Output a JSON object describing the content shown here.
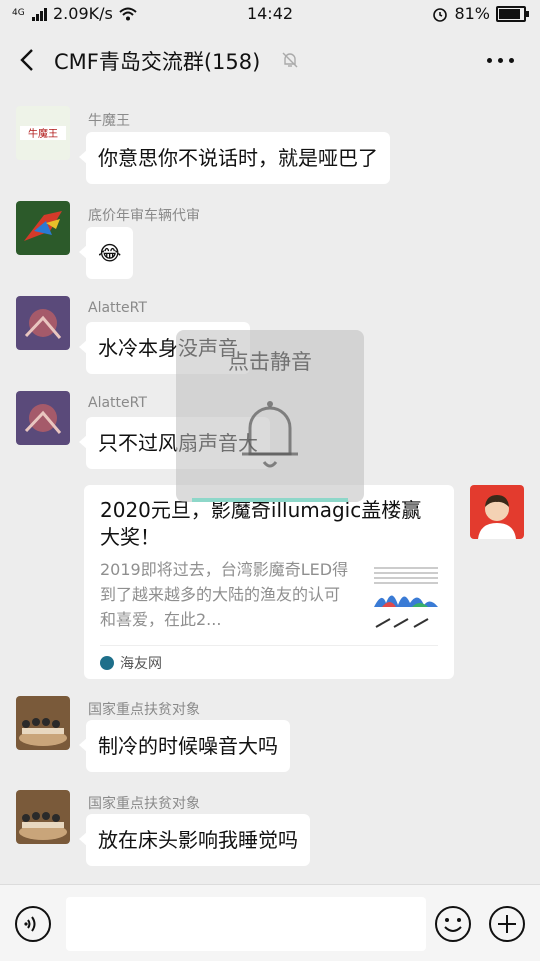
{
  "status_bar": {
    "network": "4G",
    "speed": "2.09K/s",
    "time": "14:42",
    "battery": "81%",
    "battery_level": 0.81
  },
  "header": {
    "title": "CMF青岛交流群(158)",
    "icons": [
      "back-arrow-icon",
      "mute-bell-icon",
      "more-icon"
    ]
  },
  "messages": [
    {
      "sender": "牛魔王",
      "avatar_text": "牛魔王",
      "text": "你意思你不说话时，就是哑巴了"
    },
    {
      "sender": "底价年审车辆代审",
      "text": "😂"
    },
    {
      "sender": "AlatteRT",
      "text": "水冷本身没声音"
    },
    {
      "sender": "AlatteRT",
      "text": "只不过风扇声音大"
    }
  ],
  "shared_card": {
    "title": "2020元旦，影魔奇illumagic盖楼赢大奖！",
    "description": "2019即将过去，台湾影魔奇LED得到了越来越多的大陆的渔友的认可和喜爱，在此2...",
    "source": "海友网"
  },
  "later_messages": [
    {
      "sender": "国家重点扶贫对象",
      "text": "制冷的时候噪音大吗"
    },
    {
      "sender": "国家重点扶贫对象",
      "text": "放在床头影响我睡觉吗"
    }
  ],
  "toast": {
    "label": "点击静音",
    "icon": "bell-icon"
  },
  "input_bar": {
    "placeholder": "",
    "icons": [
      "voice-icon",
      "emoji-icon",
      "plus-icon"
    ]
  },
  "colors": {
    "background": "#ededed",
    "bubble": "#ffffff",
    "accent": "#8ed7c9"
  }
}
